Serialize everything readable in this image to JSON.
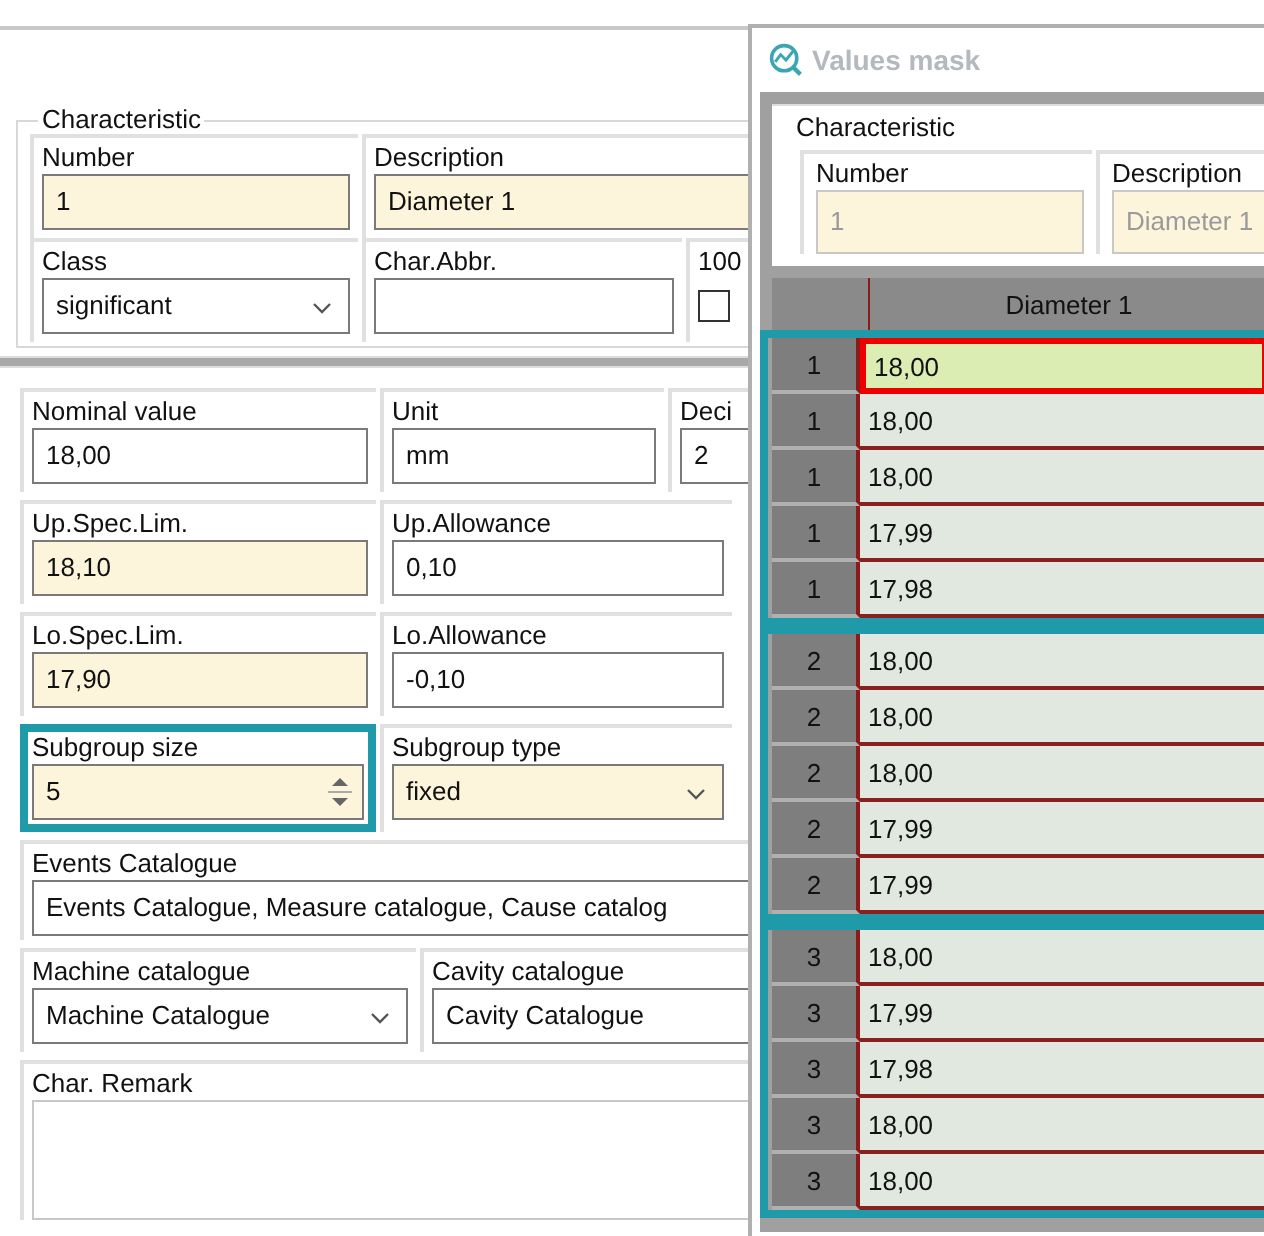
{
  "form": {
    "characteristic": {
      "title": "Characteristic",
      "rows": [
        [
          {
            "label": "Number",
            "value": "1",
            "kind": "text",
            "required": true
          },
          {
            "label": "Description",
            "value": "Diameter 1",
            "kind": "text",
            "required": true
          }
        ],
        [
          {
            "label": "Class",
            "value": "significant",
            "kind": "dropdown",
            "required": false
          },
          {
            "label": "Char.Abbr.",
            "kind": "text",
            "required": false
          },
          {
            "label": "100",
            "kind": "checkbox",
            "checked": false
          }
        ]
      ]
    },
    "rows": [
      [
        {
          "label": "Nominal value",
          "value": "18,00",
          "kind": "text",
          "required": false,
          "highlighted": false
        },
        {
          "label": "Unit",
          "value": "mm",
          "kind": "text",
          "required": false,
          "highlighted": false
        },
        {
          "label": "Deci",
          "value": "2",
          "kind": "text",
          "required": false,
          "highlighted": false
        }
      ],
      [
        {
          "label": "Up.Spec.Lim.",
          "value": "18,10",
          "kind": "text",
          "required": true,
          "highlighted": false
        },
        {
          "label": "Up.Allowance",
          "value": "0,10",
          "kind": "text",
          "required": false,
          "highlighted": false
        }
      ],
      [
        {
          "label": "Lo.Spec.Lim.",
          "value": "17,90",
          "kind": "text",
          "required": true,
          "highlighted": false
        },
        {
          "label": "Lo.Allowance",
          "value": "-0,10",
          "kind": "text",
          "required": false,
          "highlighted": false
        }
      ],
      [
        {
          "label": "Subgroup size",
          "value": "5",
          "kind": "spinner",
          "required": true,
          "highlighted": true
        },
        {
          "label": "Subgroup type",
          "value": "fixed",
          "kind": "dropdown",
          "required": true,
          "highlighted": false
        }
      ],
      [
        {
          "label": "Events Catalogue",
          "value": "Events Catalogue, Measure catalogue, Cause catalog",
          "kind": "text",
          "required": false,
          "highlighted": false
        }
      ],
      [
        {
          "label": "Machine catalogue",
          "value": "Machine Catalogue",
          "kind": "dropdown",
          "required": false,
          "highlighted": false
        },
        {
          "label": "Cavity catalogue",
          "value": "Cavity Catalogue",
          "kind": "text",
          "required": false,
          "highlighted": false
        }
      ],
      [
        {
          "label": "Char. Remark",
          "kind": "textarea",
          "required": false,
          "highlighted": false
        }
      ]
    ]
  },
  "values_mask": {
    "title": "Values mask",
    "characteristic": {
      "title": "Characteristic",
      "fields": [
        {
          "label": "Number",
          "value": "1",
          "required": true,
          "disabled": true
        },
        {
          "label": "Description",
          "value": "Diameter 1",
          "required": true,
          "disabled": true
        }
      ]
    },
    "column": "Diameter 1",
    "subgroups": [
      {
        "highlighted": true,
        "rows": [
          {
            "subgroup": "1",
            "value": "18,00",
            "selected": true
          },
          {
            "subgroup": "1",
            "value": "18,00",
            "selected": false
          },
          {
            "subgroup": "1",
            "value": "18,00",
            "selected": false
          },
          {
            "subgroup": "1",
            "value": "17,99",
            "selected": false
          },
          {
            "subgroup": "1",
            "value": "17,98",
            "selected": false
          }
        ]
      },
      {
        "highlighted": true,
        "rows": [
          {
            "subgroup": "2",
            "value": "18,00",
            "selected": false
          },
          {
            "subgroup": "2",
            "value": "18,00",
            "selected": false
          },
          {
            "subgroup": "2",
            "value": "18,00",
            "selected": false
          },
          {
            "subgroup": "2",
            "value": "17,99",
            "selected": false
          },
          {
            "subgroup": "2",
            "value": "17,99",
            "selected": false
          }
        ]
      },
      {
        "highlighted": true,
        "rows": [
          {
            "subgroup": "3",
            "value": "18,00",
            "selected": false
          },
          {
            "subgroup": "3",
            "value": "17,99",
            "selected": false
          },
          {
            "subgroup": "3",
            "value": "17,98",
            "selected": false
          },
          {
            "subgroup": "3",
            "value": "18,00",
            "selected": false
          },
          {
            "subgroup": "3",
            "value": "18,00",
            "selected": false
          }
        ]
      }
    ]
  }
}
